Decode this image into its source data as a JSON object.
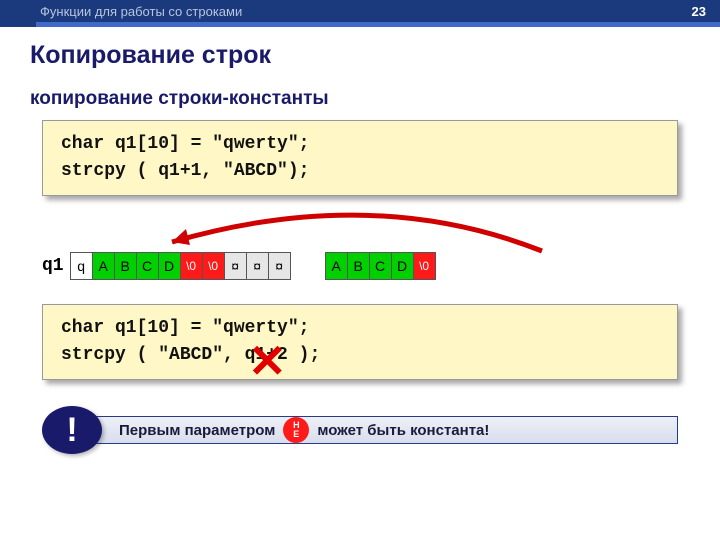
{
  "topbar": {
    "title": "Функции для работы со строками",
    "page": "23"
  },
  "title": "Копирование строк",
  "subtitle": "копирование строки-константы",
  "code1": "char q1[10] = \"qwerty\";\nstrcpy ( q1+1, \"ABCD\");",
  "code2": "char q1[10] = \"qwerty\";\nstrcpy ( \"ABCD\", q1+2 );",
  "array_label": "q1",
  "q1": [
    "q",
    "A",
    "B",
    "C",
    "D",
    "\\0",
    "\\0",
    "¤",
    "¤",
    "¤"
  ],
  "q1_colors": [
    "c-w",
    "c-g",
    "c-g",
    "c-g",
    "c-g",
    "c-r",
    "c-r",
    "c-x",
    "c-x",
    "c-x"
  ],
  "src": [
    "A",
    "B",
    "C",
    "D",
    "\\0"
  ],
  "src_colors": [
    "c-g",
    "c-g",
    "c-g",
    "c-g",
    "c-r"
  ],
  "alert": {
    "exclam": "!",
    "before": "Первым параметром",
    "ne1": "Н",
    "ne2": "Е",
    "after": "может быть константа!"
  },
  "x_mark": "✕"
}
